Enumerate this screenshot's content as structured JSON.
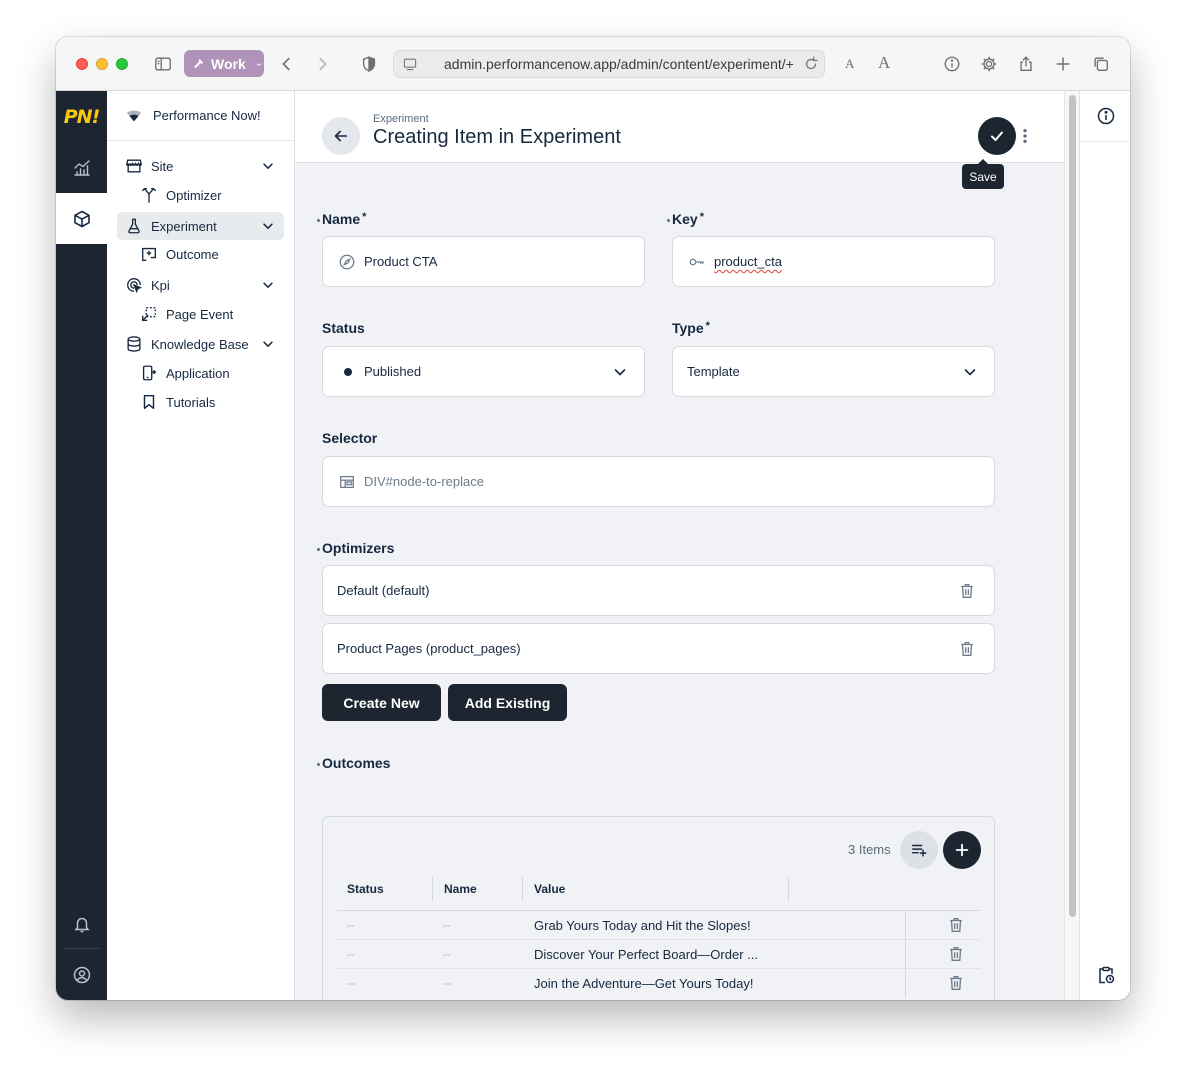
{
  "browser": {
    "profile_label": "Work",
    "url": "admin.performancenow.app/admin/content/experiment/+",
    "text_small": "A",
    "text_large": "A"
  },
  "app": {
    "logo_text": "PN!",
    "project_name": "Performance Now!"
  },
  "nav": {
    "items": [
      {
        "label": "Site"
      },
      {
        "label": "Optimizer"
      },
      {
        "label": "Experiment"
      },
      {
        "label": "Outcome"
      },
      {
        "label": "Kpi"
      },
      {
        "label": "Page Event"
      },
      {
        "label": "Knowledge Base"
      },
      {
        "label": "Application"
      },
      {
        "label": "Tutorials"
      }
    ]
  },
  "header": {
    "breadcrumb": "Experiment",
    "title": "Creating Item in Experiment",
    "save_tooltip": "Save"
  },
  "form": {
    "name": {
      "label": "Name",
      "required_mark": "*",
      "value": "Product CTA"
    },
    "key": {
      "label": "Key",
      "required_mark": "*",
      "value": "product_cta"
    },
    "status": {
      "label": "Status",
      "value": "Published"
    },
    "type": {
      "label": "Type",
      "required_mark": "*",
      "value": "Template"
    },
    "selector": {
      "label": "Selector",
      "placeholder": "DIV#node-to-replace"
    },
    "optimizers": {
      "label": "Optimizers",
      "items": [
        "Default (default)",
        "Product Pages (product_pages)"
      ],
      "create_new_label": "Create New",
      "add_existing_label": "Add Existing"
    },
    "outcomes": {
      "label": "Outcomes",
      "count_text": "3 Items",
      "columns": [
        "Status",
        "Name",
        "Value"
      ],
      "rows": [
        {
          "status": "--",
          "name": "--",
          "value": "Grab Yours Today and Hit the Slopes!"
        },
        {
          "status": "--",
          "name": "--",
          "value": "Discover Your Perfect Board—Order ..."
        },
        {
          "status": "--",
          "name": "--",
          "value": "Join the Adventure—Get Yours Today!"
        }
      ]
    }
  },
  "colors": {
    "rail_bg": "#1c2530",
    "logo_yellow": "#f9c80e",
    "primary_button": "#1c2530",
    "page_bg": "#f0f2f5",
    "profile_pill": "#b093b8"
  }
}
